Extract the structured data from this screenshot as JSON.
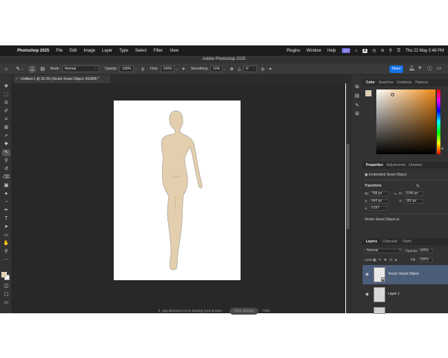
{
  "menubar": {
    "app_name": "Photoshop 2025",
    "items": [
      "File",
      "Edit",
      "Image",
      "Layer",
      "Type",
      "Select",
      "Filter",
      "View"
    ],
    "right_items": [
      "Plugins",
      "Window",
      "Help"
    ],
    "status_icons": [
      "screen-share-icon",
      "cast-icon",
      "a-icon",
      "timer-icon",
      "toggles-icon",
      "search-icon",
      "control-center-icon"
    ],
    "clock": "Thu 22 May  2:48 PM"
  },
  "window": {
    "title": "Adobe Photoshop 2025"
  },
  "options_bar": {
    "brush_size": "400",
    "mode_label": "Mode:",
    "mode_value": "Normal",
    "opacity_label": "Opacity:",
    "opacity_value": "100%",
    "flow_label": "Flow:",
    "flow_value": "100%",
    "smoothing_label": "Smoothing:",
    "smoothing_value": "10%",
    "angle_value": "0°",
    "share_label": "Share"
  },
  "document": {
    "tab_title": "Untitled-1 @ 33.3% (Vector Smart Object, RGB/8) *"
  },
  "screen_share": {
    "message": "app.livestorm.co is sharing your screen.",
    "stop_label": "Stop sharing",
    "hide_label": "Hide"
  },
  "color_panel": {
    "tabs": [
      "Color",
      "Swatches",
      "Gradients",
      "Patterns"
    ],
    "foreground": "#e2cfae",
    "background": "#000000",
    "hue_color": "#f08a14"
  },
  "properties_panel": {
    "tabs": [
      "Properties",
      "Adjustments",
      "Libraries"
    ],
    "object_type": "Embedded Smart Object",
    "transform_label": "Transform",
    "w_label": "W:",
    "w_value": "768 px",
    "h_label": "H:",
    "h_value": "3146 px",
    "x_label": "X:",
    "x_value": "643 px",
    "y_label": "Y:",
    "y_value": "181 px",
    "angle_value": "0.00°",
    "object_name": "Vector Smart Object.ai"
  },
  "layers_panel": {
    "tabs": [
      "Layers",
      "Channels",
      "Paths"
    ],
    "blend_mode": "Normal",
    "opacity_label": "Opacity:",
    "opacity_value": "100%",
    "lock_label": "Lock:",
    "fill_label": "Fill:",
    "fill_value": "100%",
    "layers": [
      {
        "name": "Vector Smart Object",
        "selected": true
      },
      {
        "name": "Layer 1",
        "selected": false
      }
    ]
  }
}
